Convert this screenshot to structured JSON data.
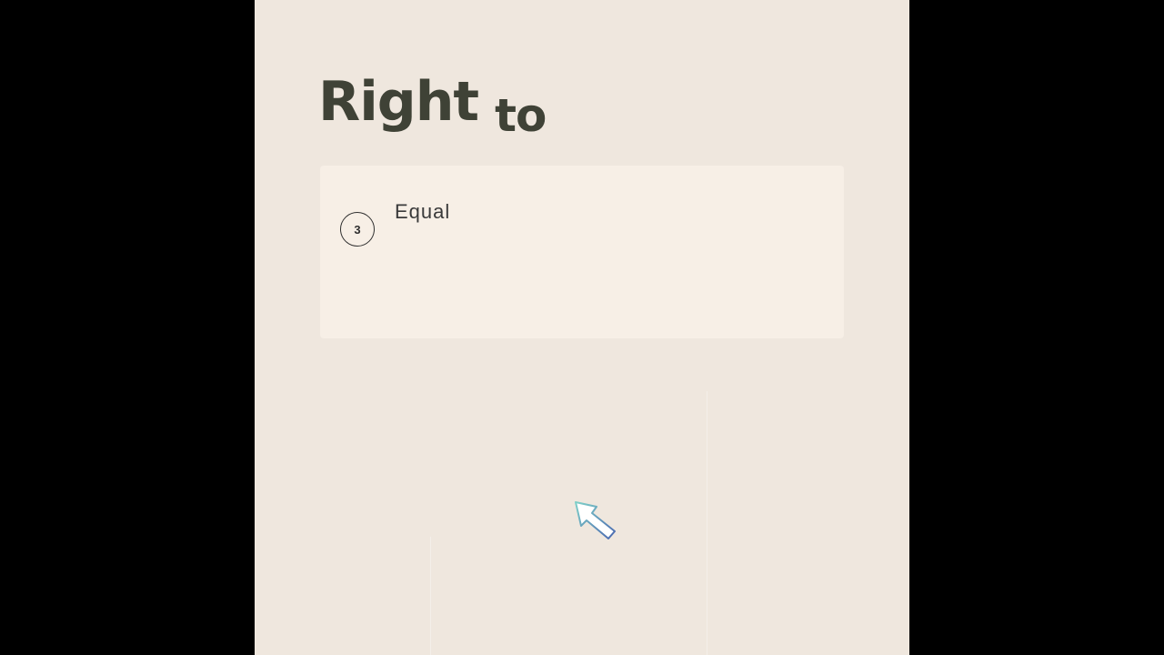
{
  "screen": {
    "background": "#000000",
    "panel_background": "#efe7de",
    "card_background": "#f7efe6",
    "heading_color": "#3f4236"
  },
  "heading": {
    "word_1": "Right",
    "word_2": "to"
  },
  "card": {
    "step_number": "3",
    "step_label": "Equal"
  },
  "cursor": {
    "icon": "mouse-pointer-icon",
    "stroke_color": "#4a68b0",
    "accent_color": "#7fd0c8"
  }
}
